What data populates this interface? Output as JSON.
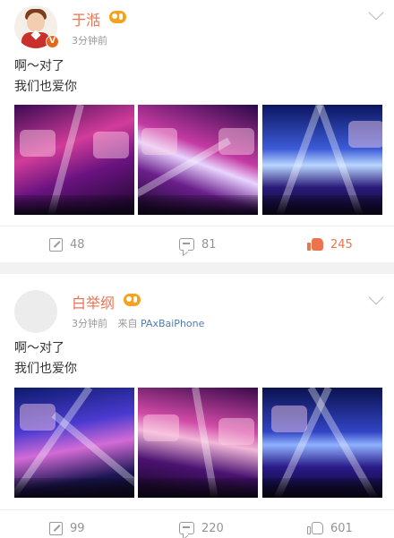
{
  "posts": [
    {
      "username": "于湉",
      "time": "3分钟前",
      "source_prefix": "",
      "source": "",
      "lines": [
        "啊～对了",
        "我们也爱你"
      ],
      "images": [
        "concert-photo",
        "concert-photo",
        "concert-photo"
      ],
      "actions": {
        "repost": "48",
        "comment": "81",
        "like": "245"
      },
      "liked": true
    },
    {
      "username": "白举纲",
      "time": "3分钟前",
      "source_prefix": "来自",
      "source": "PAxBaiPhone",
      "lines": [
        "啊～对了",
        "我们也爱你"
      ],
      "images": [
        "concert-photo",
        "concert-photo",
        "concert-photo"
      ],
      "actions": {
        "repost": "99",
        "comment": "220",
        "like": "601"
      },
      "liked": false
    }
  ],
  "colors": {
    "username": "#eb7350",
    "source_link": "#4f7cae",
    "muted": "#939393",
    "like_active": "#eb7350",
    "verified_badge": "#e0681f",
    "vip_badge": "#f6a21e"
  },
  "icons": [
    "chevron-down-icon",
    "repost-icon",
    "comment-icon",
    "like-icon",
    "verified-badge-icon",
    "vip-badge-icon"
  ]
}
